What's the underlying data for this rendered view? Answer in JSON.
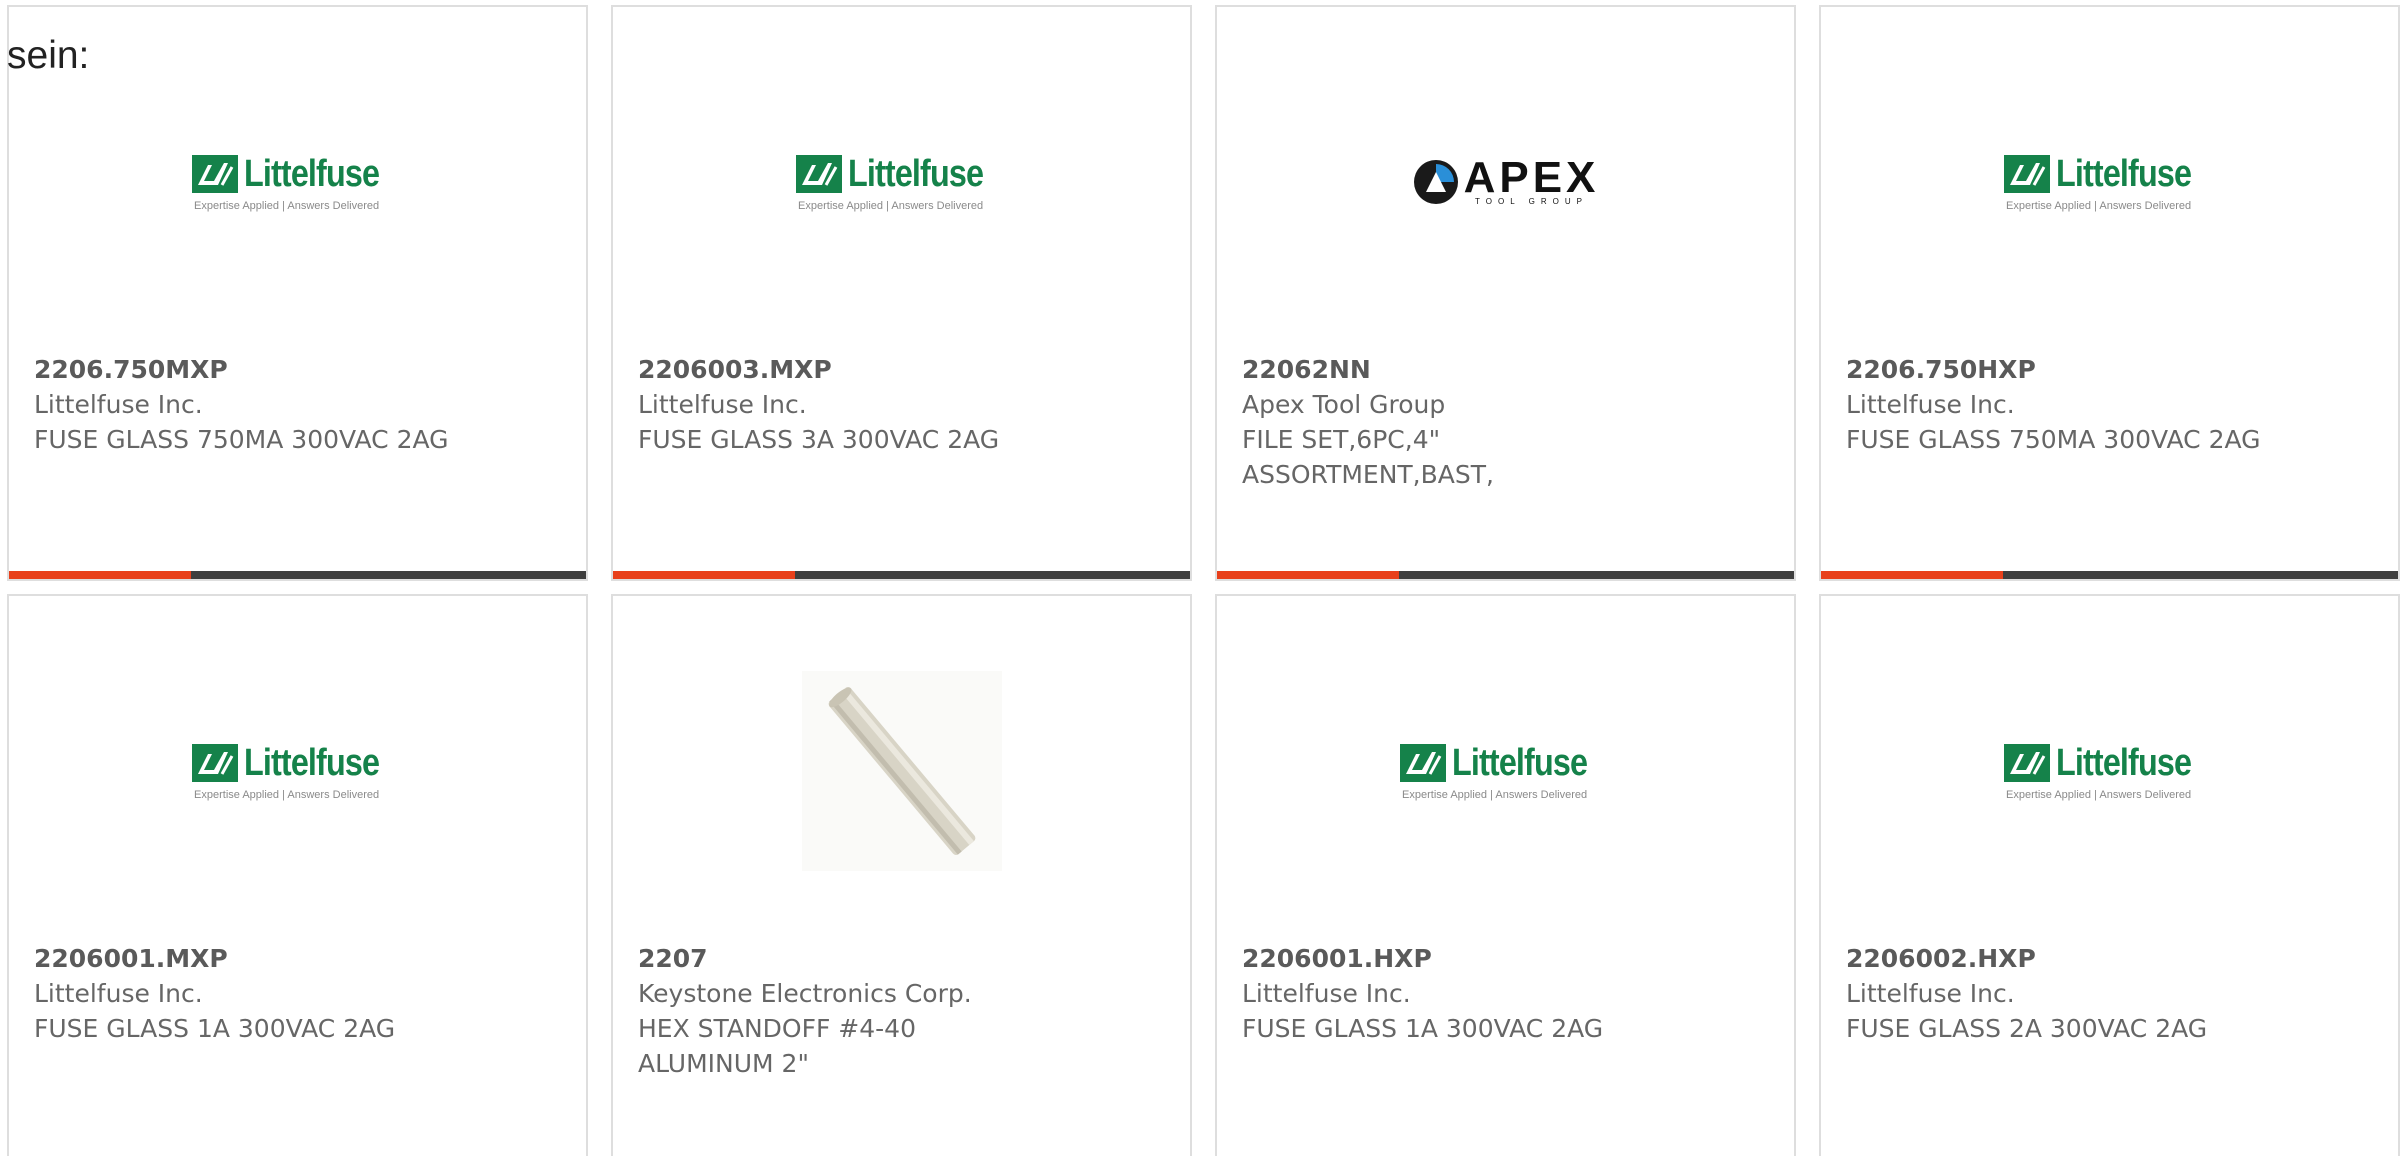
{
  "intro_text": "sein:",
  "colors": {
    "accent": "#e8401b",
    "bar": "#3e3e3e",
    "littelfuse_green": "#15824a",
    "text": "#666666"
  },
  "logos": {
    "littelfuse": {
      "word": "Littelfuse",
      "tagline": "Expertise Applied | Answers Delivered"
    },
    "apex": {
      "word": "APEX",
      "subtitle": "TOOL GROUP"
    }
  },
  "products": [
    {
      "part": "2206.750MXP",
      "manufacturer": "Littelfuse Inc.",
      "description": "FUSE GLASS 750MA 300VAC 2AG",
      "image": "littelfuse-logo"
    },
    {
      "part": "2206003.MXP",
      "manufacturer": "Littelfuse Inc.",
      "description": "FUSE GLASS 3A 300VAC 2AG",
      "image": "littelfuse-logo"
    },
    {
      "part": "22062NN",
      "manufacturer": "Apex Tool Group",
      "description": "FILE SET,6PC,4\" ASSORTMENT,BAST,",
      "image": "apex-logo"
    },
    {
      "part": "2206.750HXP",
      "manufacturer": "Littelfuse Inc.",
      "description": "FUSE GLASS 750MA 300VAC 2AG",
      "image": "littelfuse-logo"
    },
    {
      "part": "2206001.MXP",
      "manufacturer": "Littelfuse Inc.",
      "description": "FUSE GLASS 1A 300VAC 2AG",
      "image": "littelfuse-logo"
    },
    {
      "part": "2207",
      "manufacturer": "Keystone Electronics Corp.",
      "description": "HEX STANDOFF #4-40 ALUMINUM 2\"",
      "image": "standoff-photo"
    },
    {
      "part": "2206001.HXP",
      "manufacturer": "Littelfuse Inc.",
      "description": "FUSE GLASS 1A 300VAC 2AG",
      "image": "littelfuse-logo"
    },
    {
      "part": "2206002.HXP",
      "manufacturer": "Littelfuse Inc.",
      "description": "FUSE GLASS 2A 300VAC 2AG",
      "image": "littelfuse-logo"
    }
  ]
}
